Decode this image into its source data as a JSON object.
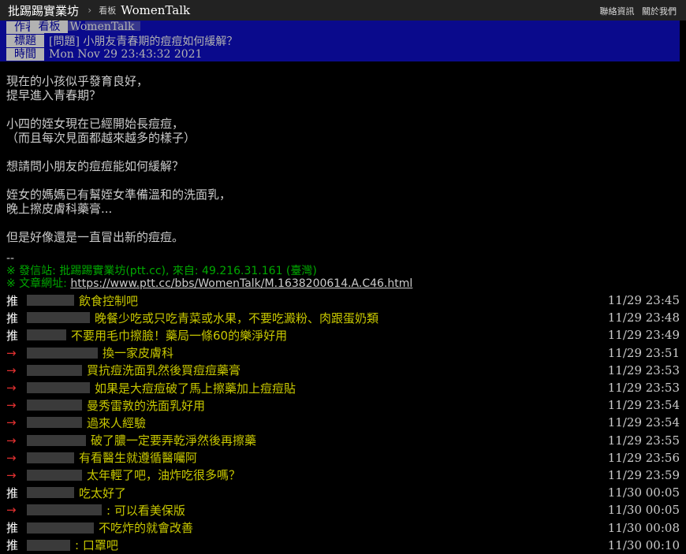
{
  "topbar": {
    "site_name": "批踢踢實業坊",
    "crumb_separator": "›",
    "crumb_label": "看板",
    "board": "WomenTalk",
    "links": [
      "聯絡資訊",
      "關於我們"
    ]
  },
  "meta": {
    "author_tag": "作者",
    "title_tag": "標題",
    "time_tag": "時間",
    "board_tag": "看板",
    "board_value": "WomenTalk",
    "title_value": "[問題] 小朋友青春期的痘痘如何緩解？",
    "time_value": "Mon Nov 29 23:43:32 2021"
  },
  "content": {
    "paragraphs": [
      "現在的小孩似乎發育良好，\n提早進入青春期？",
      "小四的姪女現在已經開始長痘痘，\n（而且每次見面都越來越多的樣子）",
      "想請問小朋友的痘痘能如何緩解？",
      "姪女的媽媽已有幫姪女準備溫和的洗面乳，\n晚上擦皮膚科藥膏...",
      "但是好像還是一直冒出新的痘痘。"
    ]
  },
  "signature": {
    "dash": "--",
    "origin": "※ 發信站: 批踢踢實業坊(ptt.cc), 來自: 49.216.31.161 (臺灣)",
    "url_label": "※ 文章網址: ",
    "url": "https://www.ptt.cc/bbs/WomenTalk/M.1638200614.A.C46.html"
  },
  "pushes": [
    {
      "tag": "推",
      "type": "push",
      "text": "飲食控制吧",
      "time": "11/29 23:45"
    },
    {
      "tag": "推",
      "type": "push",
      "text": "晚餐少吃或只吃青菜或水果，不要吃澱粉、肉跟蛋奶類",
      "time": "11/29 23:48"
    },
    {
      "tag": "推",
      "type": "push",
      "text": "不要用毛巾擦臉！藥局一條60的樂淨好用",
      "time": "11/29 23:49"
    },
    {
      "tag": "→",
      "type": "arrow",
      "text": "換一家皮膚科",
      "time": "11/29 23:51"
    },
    {
      "tag": "→",
      "type": "arrow",
      "text": "買抗痘洗面乳然後買痘痘藥膏",
      "time": "11/29 23:53"
    },
    {
      "tag": "→",
      "type": "arrow",
      "text": "如果是大痘痘破了馬上擦藥加上痘痘貼",
      "time": "11/29 23:53"
    },
    {
      "tag": "→",
      "type": "arrow",
      "text": "曼秀雷敦的洗面乳好用",
      "time": "11/29 23:54"
    },
    {
      "tag": "→",
      "type": "arrow",
      "text": "過來人經驗",
      "time": "11/29 23:54"
    },
    {
      "tag": "→",
      "type": "arrow",
      "text": "破了膿一定要弄乾淨然後再擦藥",
      "time": "11/29 23:55"
    },
    {
      "tag": "→",
      "type": "arrow",
      "text": "有看醫生就遵循醫囑阿",
      "time": "11/29 23:56"
    },
    {
      "tag": "→",
      "type": "arrow",
      "text": "太年輕了吧，油炸吃很多嗎？",
      "time": "11/29 23:59"
    },
    {
      "tag": "推",
      "type": "push",
      "text": "吃太好了",
      "time": "11/30 00:05"
    },
    {
      "tag": "→",
      "type": "arrow",
      "text": ": 可以看美保版",
      "time": "11/30 00:05"
    },
    {
      "tag": "推",
      "type": "push",
      "text": "不吃炸的就會改善",
      "time": "11/30 00:08"
    },
    {
      "tag": "推",
      "type": "push",
      "text": ": 口罩吧",
      "time": "11/30 00:10"
    }
  ],
  "colors": {
    "background": "#000000",
    "meta_background": "#0a0a8c",
    "push_text": "#c8c800",
    "arrow": "#e03030",
    "signature": "#00a800"
  }
}
